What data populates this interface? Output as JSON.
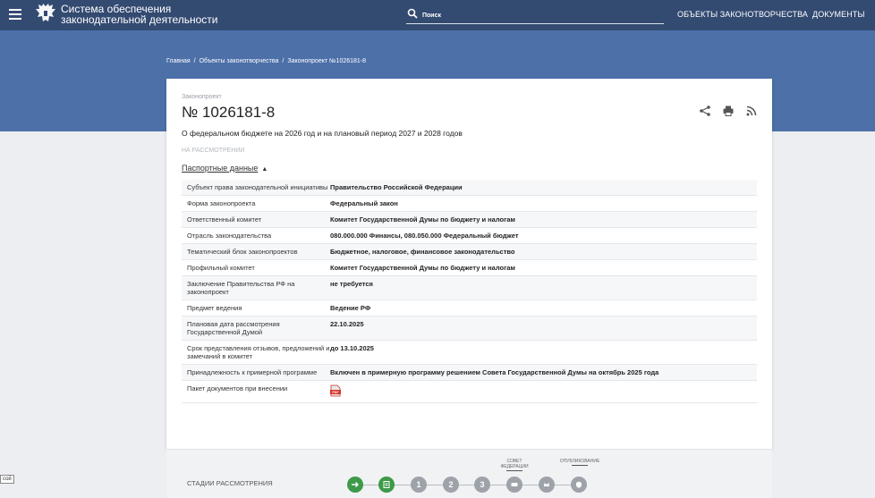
{
  "header": {
    "brand_line1": "Система обеспечения",
    "brand_line2": "законодательной деятельности",
    "search_placeholder": "Поиск",
    "nav": [
      "ОБЪЕКТЫ ЗАКОНОТВОРЧЕСТВА",
      "ДОКУМЕНТЫ"
    ]
  },
  "breadcrumb": [
    "Главная",
    "Объекты законотворчества",
    "Законопроект №1026181-8"
  ],
  "bill": {
    "type_label": "Законопроект",
    "number": "№ 1026181-8",
    "description": "О федеральном бюджете на 2026 год и на плановый период 2027 и 2028 годов",
    "status": "НА РАССМОТРЕНИИ",
    "passport_toggle": "Паспортные данные",
    "passport_arrow": "▲"
  },
  "passport": [
    {
      "label": "Субъект права законодательной инициативы",
      "value": "Правительство Российской Федерации"
    },
    {
      "label": "Форма законопроекта",
      "value": "Федеральный закон"
    },
    {
      "label": "Ответственный комитет",
      "value": "Комитет Государственной Думы по бюджету и налогам"
    },
    {
      "label": "Отрасль законодательства",
      "value": "080.000.000 Финансы, 080.050.000 Федеральный бюджет"
    },
    {
      "label": "Тематический блок законопроектов",
      "value": "Бюджетное, налоговое, финансовое законодательство"
    },
    {
      "label": "Профильный комитет",
      "value": "Комитет Государственной Думы по бюджету и налогам"
    },
    {
      "label": "Заключение Правительства РФ на законопроект",
      "value": "не требуется"
    },
    {
      "label": "Предмет ведения",
      "value": "Ведение РФ"
    },
    {
      "label": "Плановая дата рассмотрения Государственной Думой",
      "value": "22.10.2025"
    },
    {
      "label": "Срок представления отзывов, предложений и замечаний в комитет",
      "value": "до 13.10.2025"
    },
    {
      "label": "Принадлежность к примерной программе",
      "value": "Включен в примерную программу решением Совета Государственной Думы на октябрь 2025 года"
    },
    {
      "label": "Пакет документов при внесении",
      "value": ""
    }
  ],
  "pdf_label": "PDF",
  "stages": {
    "label": "СТАДИИ РАССМОТРЕНИЯ",
    "numbers": [
      "1",
      "2",
      "3"
    ],
    "cap_council": "СОВЕТ ФЕДЕРАЦИИ",
    "cap_published": "ОПУБЛИКОВАНИЕ"
  },
  "colors": {
    "topbar": "#334a71",
    "hero": "#4d70a9",
    "stage_done": "#3c9a48",
    "stage_pending": "#9ea3aa"
  },
  "corner_tag": "сой"
}
